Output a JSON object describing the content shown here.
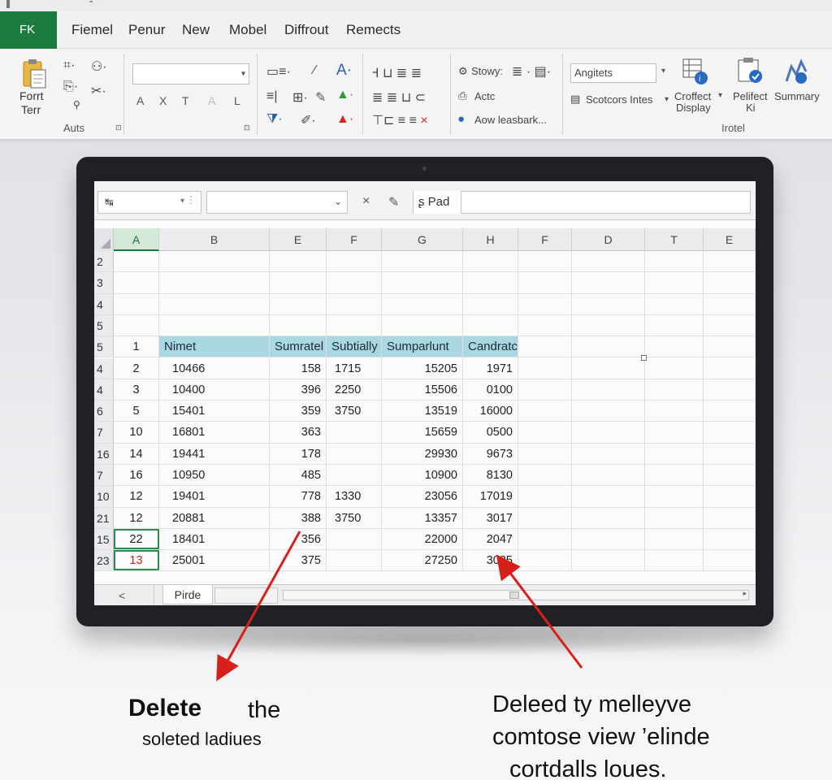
{
  "ribbon": {
    "file_tab": "FK",
    "tabs": [
      "Fiemel",
      "Penur",
      "New",
      "Mobel",
      "Diffrout",
      "Remects"
    ],
    "clipboard": {
      "paste_label_1": "Forrt",
      "paste_label_2": "Terr",
      "group_label": "Auts"
    },
    "font_tools": [
      "A",
      "X",
      "T",
      "A",
      "L"
    ],
    "styles": {
      "item1": "Stowy:",
      "item2": "Actc",
      "item3": "Aow leasbark..."
    },
    "number_format": {
      "value": "Angitets"
    },
    "scotcors": "Scotcors Intes",
    "croffect": {
      "line1": "Croffect",
      "line2": "Display"
    },
    "pelifect": {
      "line1": "Pelifect",
      "line2": "Ki"
    },
    "summary": "Summary",
    "group_label_right": "Irotel"
  },
  "formula_bar": {
    "name_box": "↹",
    "cancel_symbol": "×",
    "edit_symbol": "✎",
    "pad_label": "Pad"
  },
  "columns": [
    "A",
    "B",
    "E",
    "F",
    "G",
    "H",
    "F",
    "D",
    "T",
    "E"
  ],
  "rows": [
    {
      "rh": "2",
      "cells": [
        "",
        "",
        "",
        "",
        "",
        "",
        "",
        "",
        "",
        ""
      ]
    },
    {
      "rh": "3",
      "cells": [
        "",
        "",
        "",
        "",
        "",
        "",
        "",
        "",
        "",
        ""
      ]
    },
    {
      "rh": "4",
      "cells": [
        "",
        "",
        "",
        "",
        "",
        "",
        "",
        "",
        "",
        ""
      ]
    },
    {
      "rh": "5",
      "cells": [
        "",
        "",
        "",
        "",
        "",
        "",
        "",
        "",
        "",
        ""
      ]
    },
    {
      "rh": "5",
      "cells": [
        "1",
        "Nimet",
        "Sumratel",
        "Subtially",
        "Sumparlunt",
        "Candratce",
        "",
        "",
        "",
        ""
      ]
    },
    {
      "rh": "4",
      "cells": [
        "2",
        "10466",
        "158",
        "1715",
        "15205",
        "1971",
        "",
        "",
        "",
        ""
      ]
    },
    {
      "rh": "4",
      "cells": [
        "3",
        "10400",
        "396",
        "2250",
        "15506",
        "0100",
        "",
        "",
        "",
        ""
      ]
    },
    {
      "rh": "6",
      "cells": [
        "5",
        "15401",
        "359",
        "3750",
        "13519",
        "16000",
        "",
        "",
        "",
        ""
      ]
    },
    {
      "rh": "7",
      "cells": [
        "10",
        "16801",
        "363",
        "",
        "15659",
        "0500",
        "",
        "",
        "",
        ""
      ]
    },
    {
      "rh": "16",
      "cells": [
        "14",
        "19441",
        "178",
        "",
        "29930",
        "9673",
        "",
        "",
        "",
        ""
      ]
    },
    {
      "rh": "7",
      "cells": [
        "16",
        "10950",
        "485",
        "",
        "10900",
        "8130",
        "",
        "",
        "",
        ""
      ]
    },
    {
      "rh": "10",
      "cells": [
        "12",
        "19401",
        "778",
        "1330",
        "23056",
        "17019",
        "",
        "",
        "",
        ""
      ]
    },
    {
      "rh": "21",
      "cells": [
        "12",
        "20881",
        "388",
        "3750",
        "13357",
        "3017",
        "",
        "",
        "",
        ""
      ]
    },
    {
      "rh": "15",
      "cells": [
        "22",
        "18401",
        "356",
        "",
        "22000",
        "2047",
        "",
        "",
        "",
        ""
      ]
    },
    {
      "rh": "23",
      "cells": [
        "13",
        "25001",
        "375",
        "",
        "27250",
        "3035",
        "",
        "",
        "",
        ""
      ]
    }
  ],
  "sheet_tab": "Pirde",
  "sheet_nav": "<",
  "annotations": {
    "left_bold": "Delete",
    "left_the": "the",
    "left_sub": "soleted ladiues",
    "right_line1": "Deleed ty melleyve",
    "right_line2": "comtose view ’elinde",
    "right_line3": "cortdalls loues."
  },
  "colors": {
    "excel_green": "#1e7b3f",
    "header_blue": "#a9d7e2",
    "arrow_red": "#d8201a"
  }
}
